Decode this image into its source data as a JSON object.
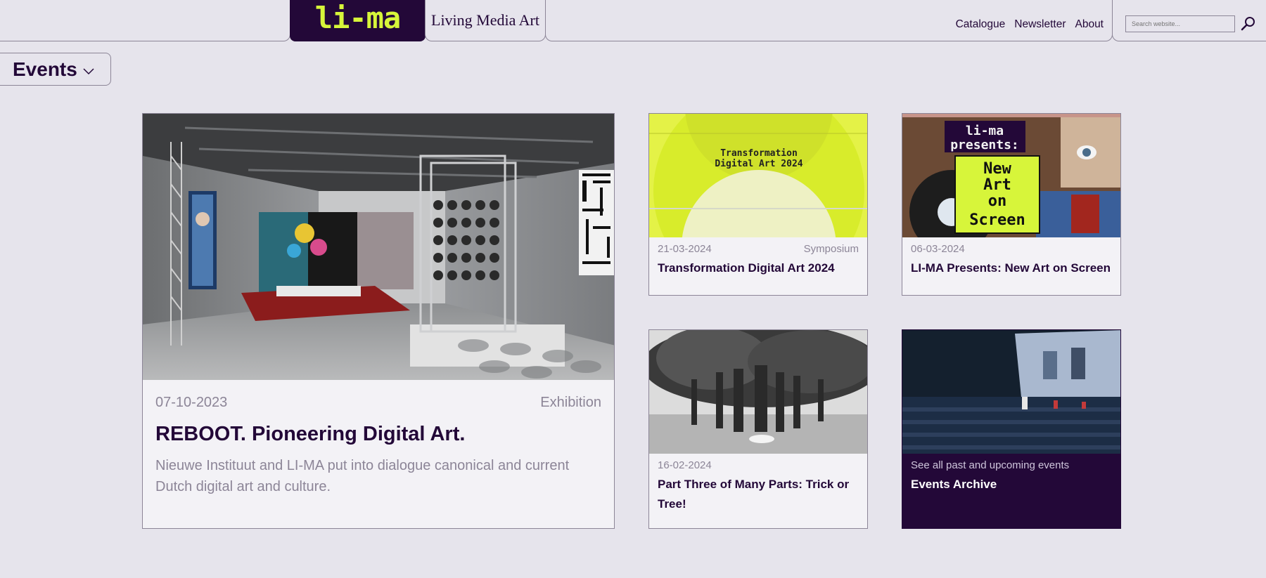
{
  "header": {
    "logo_text": "li-ma",
    "site_title": "Living Media Art",
    "nav": [
      "Catalogue",
      "Newsletter",
      "About"
    ],
    "search_placeholder": "Search website..."
  },
  "section": {
    "title": "Events"
  },
  "featured": {
    "date": "07-10-2023",
    "category": "Exhibition",
    "title": "REBOOT. Pioneering Digital Art.",
    "description": "Nieuwe Instituut and LI-MA put into dialogue canonical and current Dutch digital art and culture."
  },
  "cards": [
    {
      "date": "21-03-2024",
      "category": "Symposium",
      "title": "Transformation Digital Art 2024",
      "image_text": [
        "Transformation",
        "Digital Art 2024"
      ]
    },
    {
      "date": "06-03-2024",
      "category": "",
      "title": "LI-MA Presents: New Art on Screen",
      "image_text": [
        "li-ma",
        "presents:",
        "New",
        "Art",
        "on",
        "Screen"
      ]
    },
    {
      "date": "16-02-2024",
      "category": "",
      "title": "Part Three of Many Parts: Trick or Tree!"
    },
    {
      "date": "See all past and upcoming events",
      "category": "",
      "title": "Events Archive"
    }
  ],
  "colors": {
    "brand_purple": "#230838",
    "brand_lime": "#d7f53a",
    "background": "#e6e4ec",
    "muted_text": "#8c8597"
  }
}
